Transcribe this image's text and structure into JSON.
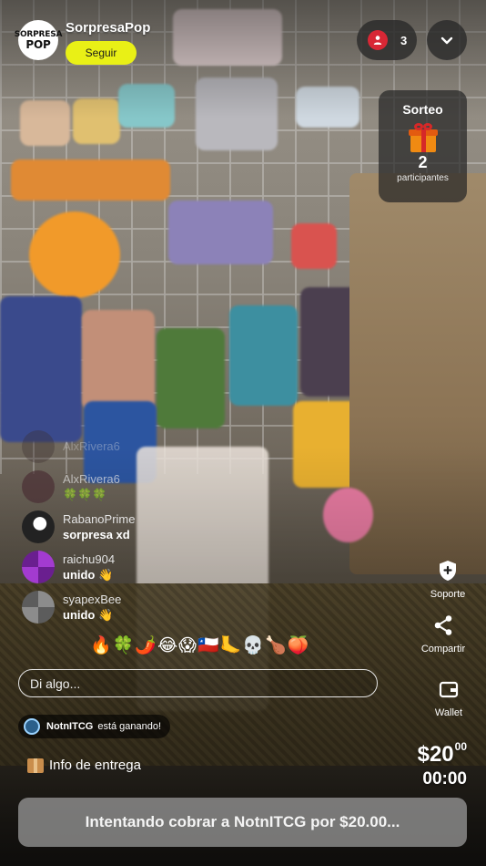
{
  "shop": {
    "name": "SorpresaPop",
    "logo_top": "SORPRESA",
    "logo_bottom": "POP",
    "follow_label": "Seguir"
  },
  "viewers": {
    "count": "3"
  },
  "giveaway": {
    "title": "Sorteo",
    "count": "2",
    "label": "participantes"
  },
  "chat": {
    "messages": [
      {
        "user": "AlxRivera6",
        "text": ""
      },
      {
        "user": "AlxRivera6",
        "text": "🍀🍀🍀"
      },
      {
        "user": "RabanoPrime",
        "text": "sorpresa xd"
      },
      {
        "user": "raichu904",
        "text": "unido 👋"
      },
      {
        "user": "syapexBee",
        "text": "unido 👋"
      }
    ],
    "emoji_bar": "🔥🍀🌶️😂😱🇨🇱🦶💀🍗🍑",
    "input_placeholder": "Di algo..."
  },
  "winner": {
    "name": "NotnITCG",
    "suffix": "está ganando!"
  },
  "delivery": {
    "label": "Info de entrega"
  },
  "rail": {
    "support": "Soporte",
    "share": "Compartir",
    "wallet": "Wallet"
  },
  "auction": {
    "price_main": "$20",
    "price_cents": "00",
    "timer": "00:00",
    "status": "Intentando cobrar a NotnITCG por $20.00..."
  },
  "colors": {
    "follow": "#e9f016",
    "viewer_dot": "#d82735",
    "accent_gift": "#f08a12"
  }
}
